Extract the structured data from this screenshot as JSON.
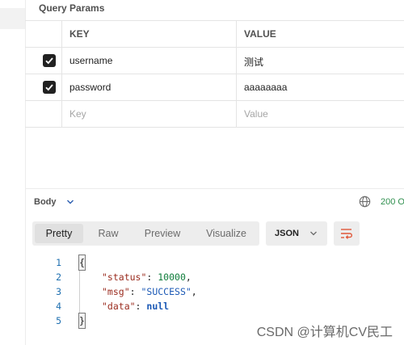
{
  "section_title": "Query Params",
  "params": {
    "header": {
      "key": "KEY",
      "value": "VALUE"
    },
    "rows": [
      {
        "checked": true,
        "key": "username",
        "value": "测试"
      },
      {
        "checked": true,
        "key": "password",
        "value": "aaaaaaaa"
      }
    ],
    "empty_row": {
      "key_placeholder": "Key",
      "value_placeholder": "Value"
    }
  },
  "response": {
    "body_label": "Body",
    "status_text": "200 O",
    "tabs": [
      "Pretty",
      "Raw",
      "Preview",
      "Visualize"
    ],
    "active_tab": "Pretty",
    "format": "JSON",
    "code_lines": [
      {
        "n": "1",
        "content": "{"
      },
      {
        "n": "2",
        "key": "\"status\"",
        "value": "10000",
        "value_type": "number",
        "trail": ","
      },
      {
        "n": "3",
        "key": "\"msg\"",
        "value": "\"SUCCESS\"",
        "value_type": "string",
        "trail": ","
      },
      {
        "n": "4",
        "key": "\"data\"",
        "value": "null",
        "value_type": "null",
        "trail": ""
      },
      {
        "n": "5",
        "content": "}"
      }
    ]
  },
  "watermark": "CSDN @计算机CV民工",
  "colors": {
    "status_ok": "#2f8f4e",
    "json_key": "#9a2b1e",
    "json_string": "#1a58b5",
    "json_number": "#0e7c3a"
  }
}
